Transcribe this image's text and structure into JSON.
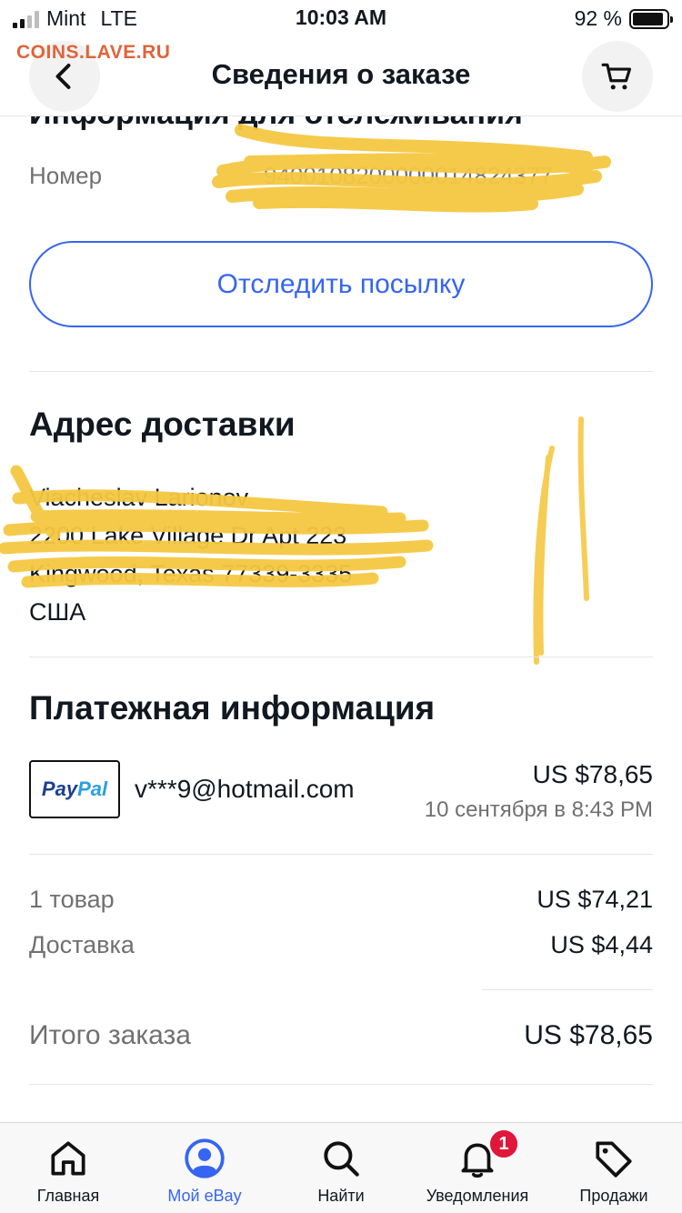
{
  "status_bar": {
    "carrier": "Mint",
    "network": "LTE",
    "time": "10:03 AM",
    "battery_percent": "92 %",
    "battery_level": 0.92
  },
  "watermark": "COINS.LAVE.RU",
  "header": {
    "title": "Сведения о заказе",
    "back_icon": "chevron-left-icon",
    "cart_icon": "cart-icon"
  },
  "tracking": {
    "heading": "Информация для отслеживания",
    "number_label": "Номер",
    "number_value": "9400108200000014824377",
    "track_button": "Отследить посылку"
  },
  "shipping": {
    "heading": "Адрес доставки",
    "name": "Viacheslav Larionov",
    "street": "2200 Lake Village Dr Apt 223",
    "city": "Kingwood, Texas 77339-3335",
    "country": "США"
  },
  "payment": {
    "heading": "Платежная информация",
    "logo_text_a": "Pay",
    "logo_text_b": "Pal",
    "email": "v***9@hotmail.com",
    "amount": "US $78,65",
    "date": "10 сентября в 8:43 PM",
    "items_label": "1 товар",
    "items_value": "US $74,21",
    "shipping_label": "Доставка",
    "shipping_value": "US $4,44",
    "total_label": "Итого заказа",
    "total_value": "US $78,65"
  },
  "colors": {
    "accent": "#3665f3",
    "badge": "#e0163a",
    "scribble": "#f5c842",
    "watermark": "#e0643a"
  },
  "tabbar": {
    "items": [
      {
        "label": "Главная",
        "icon": "home-icon",
        "active": false
      },
      {
        "label": "Мой eBay",
        "icon": "profile-icon",
        "active": true
      },
      {
        "label": "Найти",
        "icon": "search-icon",
        "active": false
      },
      {
        "label": "Уведомления",
        "icon": "bell-icon",
        "active": false,
        "badge": "1"
      },
      {
        "label": "Продажи",
        "icon": "tag-icon",
        "active": false
      }
    ]
  }
}
